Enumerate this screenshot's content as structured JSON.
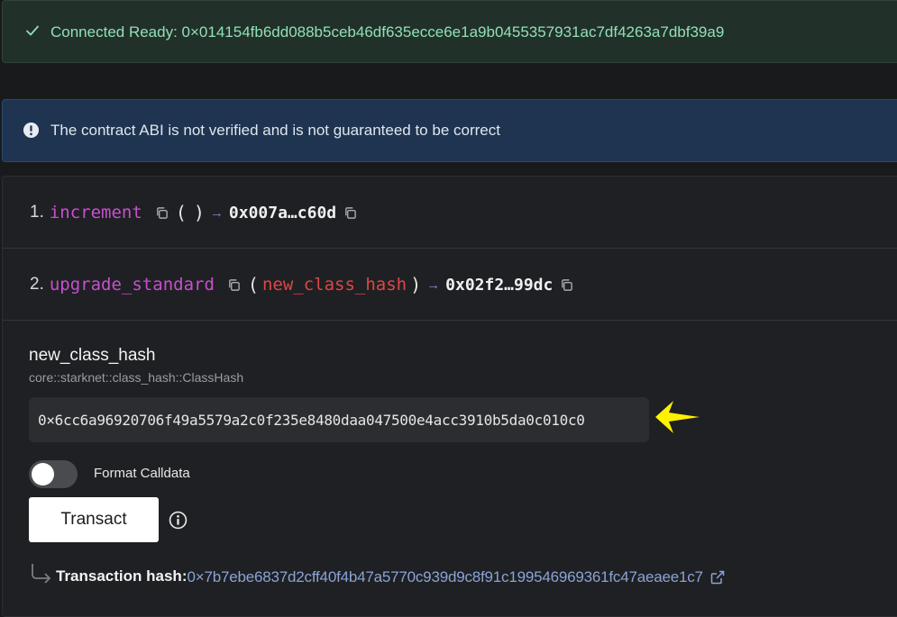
{
  "status": {
    "connected_message": "Connected Ready: 0×014154fb6dd088b5ceb46df635ecce6e1a9b0455357931ac7df4263a7dbf39a9",
    "success_color": "#8fe0b6"
  },
  "notice": {
    "message": "The contract ABI is not verified and is not guaranteed to be correct"
  },
  "functions": [
    {
      "index": "1.",
      "name": "increment",
      "open_paren": "(",
      "params": "",
      "close_paren": ")",
      "arrow": "→",
      "selector": "0x007a…c60d"
    },
    {
      "index": "2.",
      "name": "upgrade_standard",
      "open_paren": "(",
      "params": "new_class_hash",
      "close_paren": ")",
      "arrow": "→",
      "selector": "0x02f2…99dc"
    }
  ],
  "form": {
    "field_name": "new_class_hash",
    "field_type": "core::starknet::class_hash::ClassHash",
    "field_value": "0×6cc6a96920706f49a5579a2c0f235e8480daa047500e4acc3910b5da0c010c0",
    "format_calldata_label": "Format Calldata",
    "format_calldata_enabled": false,
    "transact_label": "Transact"
  },
  "result": {
    "label": "Transaction hash:",
    "hash": "0×7b7ebe6837d2cff40f4b47a5770c939d9c8f91c199546969361fc47aeaee1c7"
  },
  "icons": {
    "status": "check-icon",
    "notice": "exclamation-circle-icon",
    "copy": "copy-icon",
    "help": "info-icon",
    "external": "external-link-icon",
    "pointer": "yellow-arrow-icon"
  }
}
